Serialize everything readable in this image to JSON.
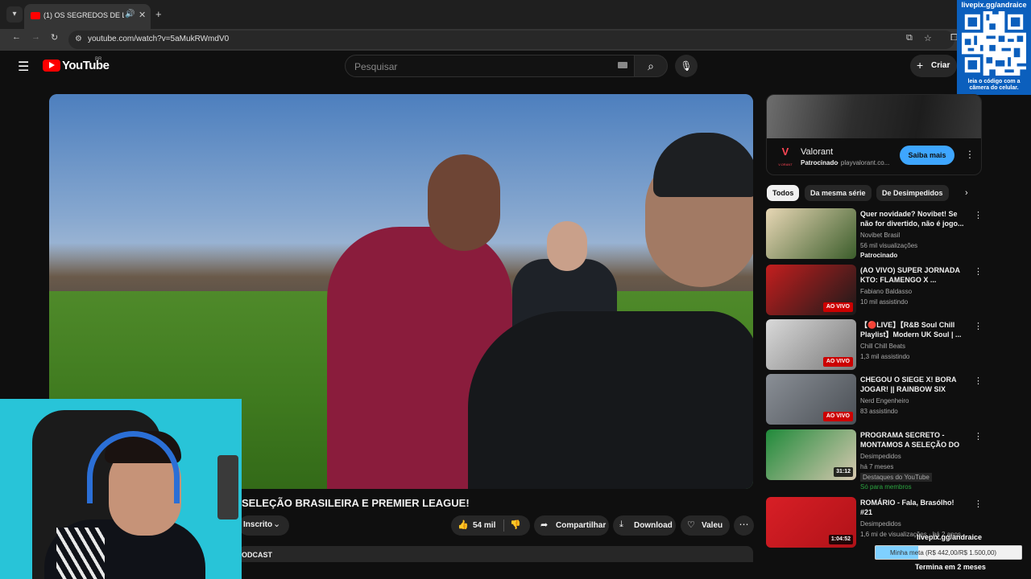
{
  "browser": {
    "tab_title": "(1) OS SEGREDOS DE LUCA",
    "url": "youtube.com/watch?v=5aMukRWmdV0"
  },
  "qr": {
    "title": "livepix.gg/andraice",
    "caption": "leia o código com a câmera do celular."
  },
  "header": {
    "logo_text": "YouTube",
    "country": "BR",
    "search_placeholder": "Pesquisar",
    "create_label": "Criar"
  },
  "video": {
    "title": "SELEÇÃO BRASILEIRA E PREMIER LEAGUE!",
    "subscribe_label": "Inscrito",
    "likes": "54 mil",
    "share_label": "Compartilhar",
    "download_label": "Download",
    "thanks_label": "Valeu",
    "description_snippet": "ODCAST"
  },
  "ad": {
    "title": "Valorant",
    "sponsored": "Patrocinado",
    "domain": "· playvalorant.co...",
    "cta": "Saiba mais",
    "logo_sub": "V.ORANT"
  },
  "chips": [
    "Todos",
    "Da mesma série",
    "De Desimpedidos"
  ],
  "related": [
    {
      "title": "Quer novidade? Novibet! Se não for divertido, não é jogo...",
      "channel": "Novibet Brasil",
      "meta": "56 mil visualizações",
      "extra": "Patrocinado",
      "badge": "",
      "colors": [
        "#e8d7b5",
        "#3b5d2b"
      ]
    },
    {
      "title": "(AO VIVO) SUPER JORNADA KTO: FLAMENGO X ...",
      "channel": "Fabiano Baldasso",
      "meta": "10 mil assistindo",
      "extra": "",
      "badge": "AO VIVO",
      "colors": [
        "#c41e1e",
        "#1a1a1a"
      ]
    },
    {
      "title": "【🔴LIVE】【R&B Soul Chill Playlist】Modern UK Soul | ...",
      "channel": "Chill Chill Beats",
      "meta": "1,3 mil assistindo",
      "extra": "",
      "badge": "AO VIVO",
      "colors": [
        "#d9d9d9",
        "#7a7a7a"
      ]
    },
    {
      "title": "CHEGOU O SIEGE X! BORA JOGAR! || RAINBOW SIX SIEGE",
      "channel": "Nerd Engenheiro",
      "meta": "83 assistindo",
      "extra": "",
      "badge": "AO VIVO",
      "colors": [
        "#8a8f96",
        "#4a4f55"
      ]
    },
    {
      "title": "PROGRAMA SECRETO - MONTAMOS A SELEÇÃO DO ...",
      "channel": "Desimpedidos",
      "meta": "há 7 meses",
      "extra": "Destaques do YouTube",
      "extra2": "Só para membros",
      "badge": "31:12",
      "colors": [
        "#1f8a3a",
        "#d7c8b0"
      ]
    },
    {
      "title": "ROMÁRIO - Fala, Brasólho! #21",
      "channel": "Desimpedidos",
      "meta": "1,6 mi de visualizações · há 2 anos",
      "extra": "",
      "badge": "1:04:52",
      "colors": [
        "#d81f26",
        "#b01218"
      ]
    }
  ],
  "livepix": {
    "url": "livepix.gg/andraice",
    "goal_text": "Minha meta (R$ 442,00/R$ 1.500,00)",
    "goal_fraction": 0.295,
    "ends": "Termina em 2 meses"
  }
}
